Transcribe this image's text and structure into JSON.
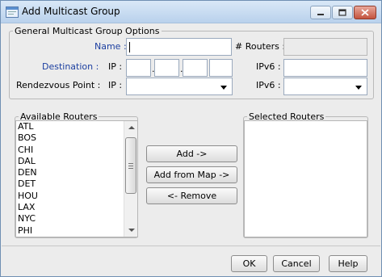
{
  "window": {
    "title": "Add Multicast Group",
    "controls": [
      "minimize-icon",
      "maximize-icon",
      "close-icon"
    ]
  },
  "options_group": {
    "legend": "General Multicast Group Options",
    "name_label": "Name :",
    "name_value": "",
    "routers_label": "# Routers :",
    "routers_value": "",
    "destination_label": "Destination :",
    "ip_label": "IP :",
    "ipv6_label": "IPv6 :",
    "ip_octets": [
      "",
      "",
      "",
      ""
    ],
    "ip_separator": ".",
    "destination_ipv6_value": "",
    "rendezvous_label": "Rendezvous Point :",
    "rp_ip_label": "IP :",
    "rp_ip_selected": "",
    "rp_ipv6_label": "IPv6 :",
    "rp_ipv6_selected": ""
  },
  "available_routers": {
    "legend": "Available Routers",
    "items": [
      "ATL",
      "BOS",
      "CHI",
      "DAL",
      "DEN",
      "DET",
      "HOU",
      "LAX",
      "NYC",
      "PHI"
    ]
  },
  "selected_routers": {
    "legend": "Selected Routers",
    "items": []
  },
  "transfer_buttons": {
    "add": "Add ->",
    "add_from_map": "Add from Map ->",
    "remove": "<- Remove"
  },
  "dialog_buttons": {
    "ok": "OK",
    "cancel": "Cancel",
    "help": "Help"
  }
}
